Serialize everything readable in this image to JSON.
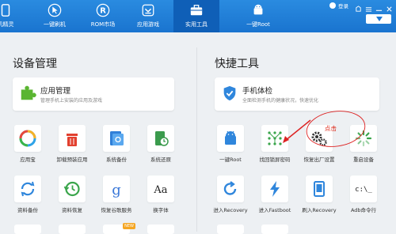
{
  "nav": {
    "items": [
      {
        "label": "机精灵",
        "icon": "phone-assistant-icon"
      },
      {
        "label": "一键刷机",
        "icon": "cursor-flash-icon"
      },
      {
        "label": "ROM市场",
        "icon": "rom-market-icon"
      },
      {
        "label": "应用游戏",
        "icon": "apps-games-icon"
      },
      {
        "label": "实用工具",
        "icon": "toolbox-icon",
        "active": true
      },
      {
        "label": "一键Root",
        "icon": "android-root-icon"
      }
    ],
    "login_label": "登录"
  },
  "left_section": {
    "title": "设备管理",
    "card": {
      "title": "应用管理",
      "subtitle": "管理手机上安装的应用及游戏",
      "icon": "puzzle-icon"
    },
    "tools": [
      {
        "label": "应用宝",
        "icon": "yingyongbao-icon"
      },
      {
        "label": "卸载预装应用",
        "icon": "trash-icon"
      },
      {
        "label": "系统备份",
        "icon": "system-backup-icon"
      },
      {
        "label": "系统还原",
        "icon": "system-restore-icon"
      },
      {
        "label": "资料备份",
        "icon": "sync-icon"
      },
      {
        "label": "资料恢复",
        "icon": "history-icon"
      },
      {
        "label": "恢复谷歌服务",
        "icon": "google-icon"
      },
      {
        "label": "换字体",
        "icon": "font-icon"
      }
    ],
    "badge": "NEW"
  },
  "right_section": {
    "title": "快捷工具",
    "card": {
      "title": "手机体检",
      "subtitle": "全面检测手机的健康状况，快速优化",
      "icon": "shield-check-icon"
    },
    "tools": [
      {
        "label": "一键Root",
        "icon": "android-root-icon"
      },
      {
        "label": "找回锁屏密码",
        "icon": "pattern-lock-icon"
      },
      {
        "label": "恢复出厂设置",
        "icon": "gears-icon"
      },
      {
        "label": "重启设备",
        "icon": "loading-icon"
      },
      {
        "label": "进入Recovery",
        "icon": "refresh-arrow-icon"
      },
      {
        "label": "进入Fastboot",
        "icon": "lightning-icon"
      },
      {
        "label": "刷入Recovery",
        "icon": "tablet-icon"
      },
      {
        "label": "Adb命令行",
        "icon": "terminal-icon"
      }
    ]
  },
  "annotation": {
    "text": "点击"
  },
  "colors": {
    "nav": "#1f7fd9",
    "nav_active": "#0f5fb7",
    "annotation": "#dd2222"
  }
}
